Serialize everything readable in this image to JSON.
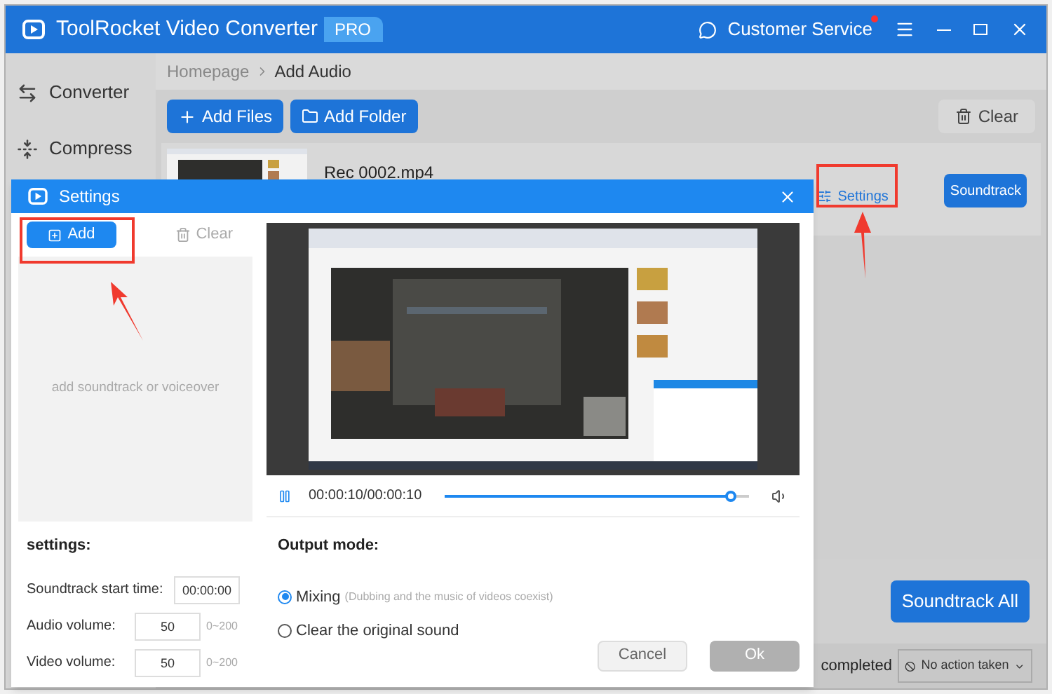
{
  "window": {
    "title": "ToolRocket Video Converter",
    "badge": "PRO",
    "customer_service": "Customer Service"
  },
  "sidebar": {
    "items": [
      {
        "label": "Converter",
        "kind": "convert"
      },
      {
        "label": "Compress",
        "kind": "compress"
      }
    ]
  },
  "breadcrumb": [
    "Homepage",
    "Add Audio"
  ],
  "toolbar": {
    "buttons": [
      {
        "label": "Add Files",
        "kind": "files"
      },
      {
        "label": "Add Folder",
        "kind": "folder"
      }
    ],
    "clear": "Clear"
  },
  "file": {
    "name": "Rec 0002.mp4",
    "settings": "Settings",
    "soundtrack": "Soundtrack"
  },
  "bottom": {
    "soundtrack_all": "Soundtrack All",
    "status": "completed",
    "action": "No action taken"
  },
  "dialog": {
    "title": "Settings",
    "add": "Add",
    "clear": "Clear",
    "empty": "add soundtrack or voiceover",
    "settings_label": "settings:",
    "fields": [
      {
        "label": "Soundtrack start time:",
        "value": "00:00:00"
      },
      {
        "label": "Audio volume:",
        "value": "50",
        "range": "0~200"
      },
      {
        "label": "Video volume:",
        "value": "50",
        "range": "0~200"
      }
    ],
    "player": {
      "time": "00:00:10/00:00:10",
      "level": 0.94,
      "playing": true
    },
    "output_label": "Output mode:",
    "modes": [
      {
        "label": "Mixing",
        "note": "(Dubbing and the music of videos coexist)",
        "selected": true
      },
      {
        "label": "Clear the original sound",
        "selected": false
      }
    ],
    "buttons": [
      {
        "label": "Cancel",
        "kind": "cancel"
      },
      {
        "label": "Ok",
        "kind": "ok"
      }
    ]
  }
}
